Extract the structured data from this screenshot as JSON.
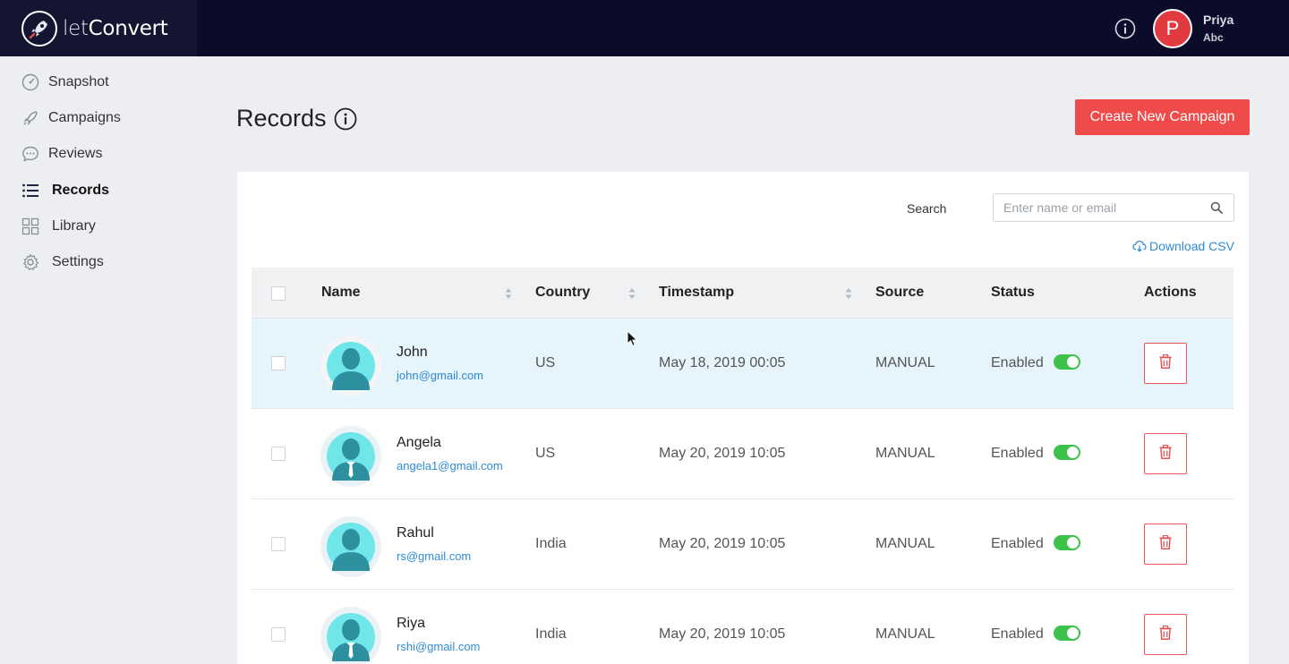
{
  "header": {
    "logo_light": "let",
    "logo_bold": "Convert",
    "user_initial": "P",
    "user_name": "Priya",
    "user_sub": "Abc"
  },
  "sidebar": {
    "items": [
      {
        "label": "Snapshot",
        "icon": "gauge-icon"
      },
      {
        "label": "Campaigns",
        "icon": "rocket-icon"
      },
      {
        "label": "Reviews",
        "icon": "chat-bubble-icon"
      },
      {
        "label": "Records",
        "icon": "list-icon",
        "active": true
      },
      {
        "label": "Library",
        "icon": "grid-icon"
      },
      {
        "label": "Settings",
        "icon": "gear-icon"
      }
    ]
  },
  "main": {
    "title": "Records",
    "create_button": "Create New Campaign",
    "search_label": "Search",
    "search_placeholder": "Enter name or email",
    "download_csv": "Download CSV"
  },
  "table": {
    "columns": [
      "Name",
      "Country",
      "Timestamp",
      "Source",
      "Status",
      "Actions"
    ],
    "rows": [
      {
        "name": "John",
        "email": "john@gmail.com",
        "country": "US",
        "timestamp": "May 18, 2019 00:05",
        "source": "MANUAL",
        "status": "Enabled",
        "enabled": true,
        "avatar": "person-avatar",
        "highlighted": true
      },
      {
        "name": "Angela",
        "email": "angela1@gmail.com",
        "country": "US",
        "timestamp": "May 20, 2019 10:05",
        "source": "MANUAL",
        "status": "Enabled",
        "enabled": true,
        "avatar": "person-tie-avatar"
      },
      {
        "name": "Rahul",
        "email": "rs@gmail.com",
        "country": "India",
        "timestamp": "May 20, 2019 10:05",
        "source": "MANUAL",
        "status": "Enabled",
        "enabled": true,
        "avatar": "person-avatar"
      },
      {
        "name": "Riya",
        "email": "rshi@gmail.com",
        "country": "India",
        "timestamp": "May 20, 2019 10:05",
        "source": "MANUAL",
        "status": "Enabled",
        "enabled": true,
        "avatar": "person-tie-avatar"
      }
    ]
  },
  "colors": {
    "topbar": "#0b0c2a",
    "accent_red": "#ef4b4b",
    "link_blue": "#2f8bd3",
    "toggle_green": "#3cc24a",
    "row_highlight": "#e6f4fb"
  }
}
